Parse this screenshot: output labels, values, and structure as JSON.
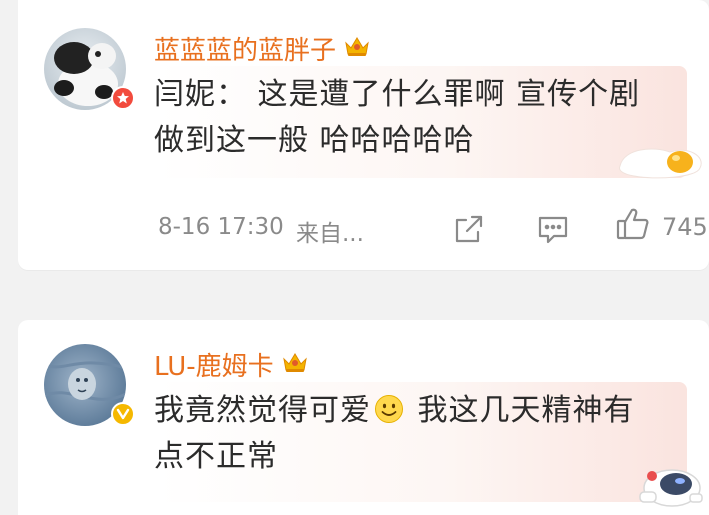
{
  "comments": [
    {
      "username": "蓝蓝蓝的蓝胖子",
      "text_line1": "闫妮： 这是遭了什么罪啊 宣传个剧",
      "text_line2": "做到这一般 哈哈哈哈哈",
      "timestamp": "8-16 17:30",
      "source": "来自...",
      "likes": "745",
      "badge_icon": "verified-red-badge-icon",
      "sticker": "fried-egg-sticker",
      "accent_color": "#e8701f"
    },
    {
      "username": "LU-鹿姆卡",
      "text_part1": "我竟然觉得可爱",
      "emoji": "smiley-emoji",
      "text_part2": " 我这几天精神有",
      "text_line2": "点不正常",
      "badge_icon": "verified-yellow-badge-icon",
      "sticker": "astronaut-sticker",
      "accent_color": "#e8701f"
    }
  ]
}
